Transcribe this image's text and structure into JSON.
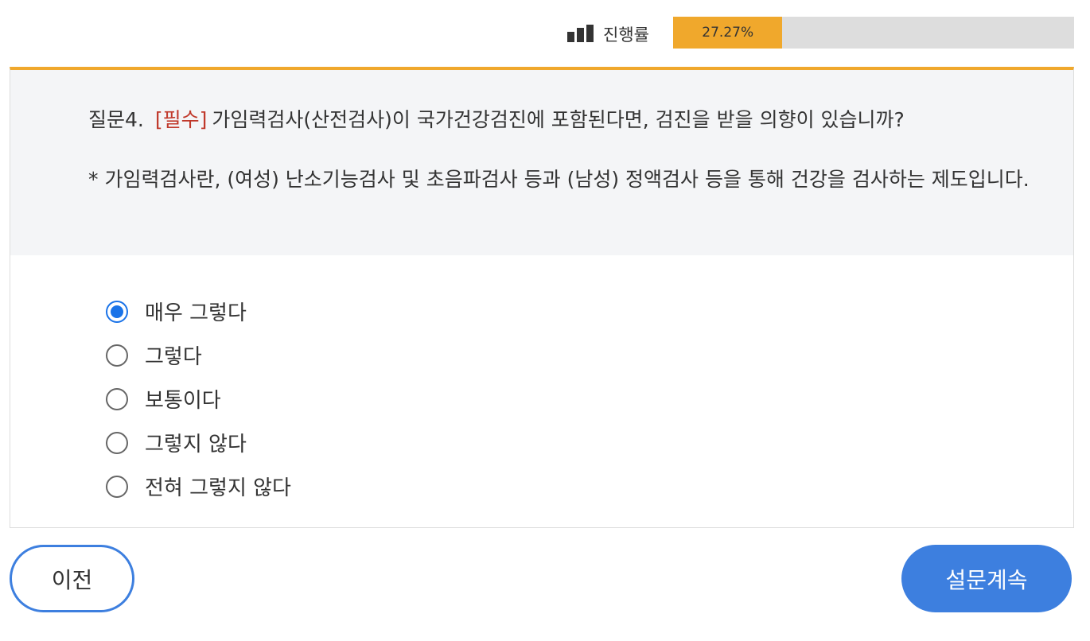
{
  "progress": {
    "icon": "bar-chart-icon",
    "label": "진행률",
    "percent_text": "27.27%",
    "value": 27.27,
    "fill_color": "#f0a82c",
    "track_color": "#dddddd"
  },
  "question": {
    "number": "질문4.",
    "required_tag": "[필수]",
    "text": "가임력검사(산전검사)이 국가건강검진에 포함된다면, 검진을 받을 의향이 있습니까?",
    "note": "* 가임력검사란, (여성) 난소기능검사 및 초음파검사 등과 (남성) 정액검사 등을 통해 건강을 검사하는 제도입니다.",
    "required_color": "#c0392b"
  },
  "options": [
    {
      "label": "매우 그렇다",
      "selected": true
    },
    {
      "label": "그렇다",
      "selected": false
    },
    {
      "label": "보통이다",
      "selected": false
    },
    {
      "label": "그렇지 않다",
      "selected": false
    },
    {
      "label": "전혀 그렇지 않다",
      "selected": false
    }
  ],
  "buttons": {
    "prev_label": "이전",
    "next_label": "설문계속",
    "accent_color": "#3d7fdf"
  }
}
